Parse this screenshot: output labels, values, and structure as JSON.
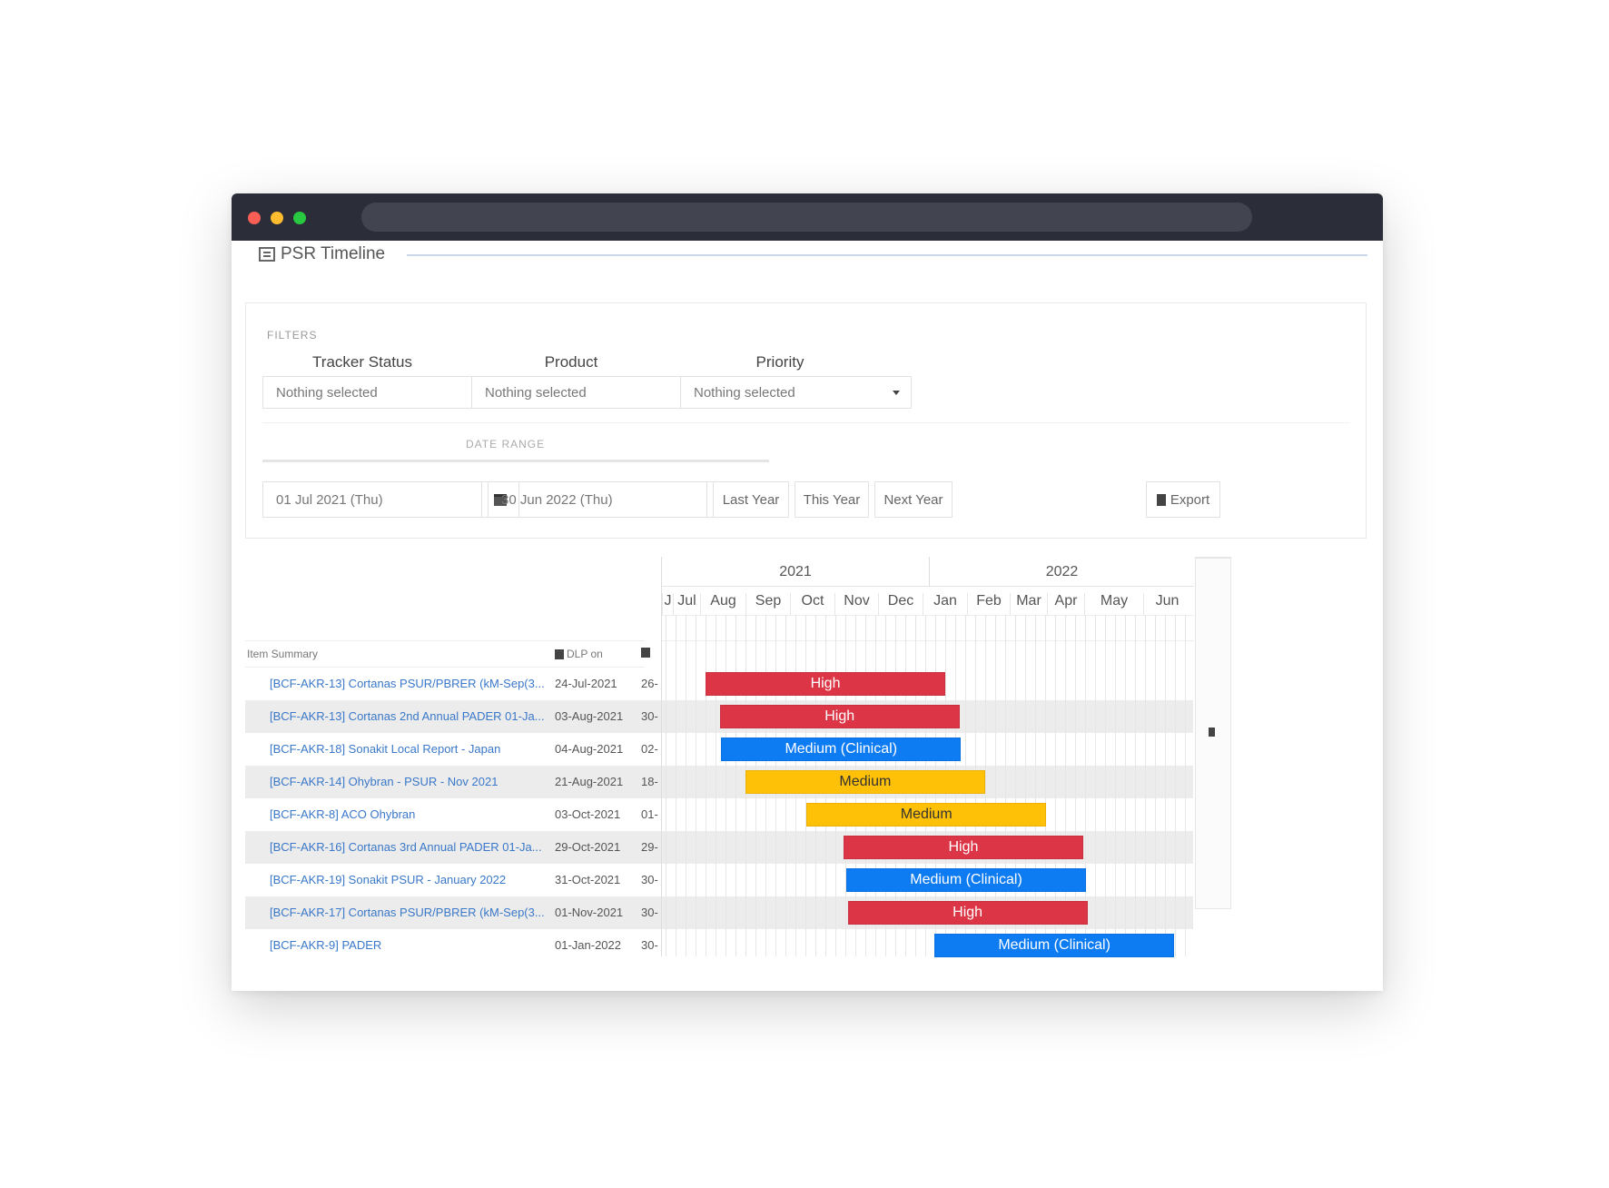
{
  "page": {
    "title": "PSR Timeline"
  },
  "filters": {
    "caption": "FILTERS",
    "tracker_status": {
      "label": "Tracker Status",
      "value": "Nothing selected"
    },
    "product": {
      "label": "Product",
      "value": "Nothing selected"
    },
    "priority": {
      "label": "Priority",
      "value": "Nothing selected"
    }
  },
  "date_range": {
    "caption": "DATE RANGE",
    "start": "01 Jul 2021 (Thu)",
    "end": "30 Jun 2022 (Thu)",
    "buttons": [
      "Last Year",
      "This Year",
      "Next Year"
    ],
    "export_label": "Export"
  },
  "table": {
    "columns": {
      "summary": "Item Summary",
      "start": "DLP on",
      "end": ""
    },
    "rows": [
      {
        "summary": "[BCF-AKR-13] Cortanas PSUR/PBRER (kM-Sep(3...",
        "start": "24-Jul-2021",
        "end": "26-",
        "priority": "High"
      },
      {
        "summary": "[BCF-AKR-13] Cortanas 2nd Annual PADER 01-Ja...",
        "start": "03-Aug-2021",
        "end": "30-",
        "priority": "High"
      },
      {
        "summary": "[BCF-AKR-18] Sonakit Local Report - Japan",
        "start": "04-Aug-2021",
        "end": "02-",
        "priority": "Medium (Clinical)"
      },
      {
        "summary": "[BCF-AKR-14] Ohybran - PSUR - Nov 2021",
        "start": "21-Aug-2021",
        "end": "18-",
        "priority": "Medium"
      },
      {
        "summary": "[BCF-AKR-8] ACO Ohybran",
        "start": "03-Oct-2021",
        "end": "01-",
        "priority": "Medium"
      },
      {
        "summary": "[BCF-AKR-16] Cortanas 3rd Annual PADER 01-Ja...",
        "start": "29-Oct-2021",
        "end": "29-",
        "priority": "High"
      },
      {
        "summary": "[BCF-AKR-19] Sonakit PSUR - January 2022",
        "start": "31-Oct-2021",
        "end": "30-",
        "priority": "Medium (Clinical)"
      },
      {
        "summary": "[BCF-AKR-17] Cortanas PSUR/PBRER (kM-Sep(3...",
        "start": "01-Nov-2021",
        "end": "30-",
        "priority": "High"
      },
      {
        "summary": "[BCF-AKR-9] PADER",
        "start": "01-Jan-2022",
        "end": "30-",
        "priority": "Medium (Clinical)"
      }
    ]
  },
  "timeline": {
    "years": [
      "2021",
      "2022"
    ],
    "months": [
      "J",
      "Jul",
      "Aug",
      "Sep",
      "Oct",
      "Nov",
      "Dec",
      "Jan",
      "Feb",
      "Mar",
      "Apr",
      "May",
      "Jun"
    ]
  },
  "colors": {
    "High": "#dc3545",
    "Medium": "#ffc107",
    "Medium (Clinical)": "#0d7bf2",
    "link": "#3a78c9"
  }
}
